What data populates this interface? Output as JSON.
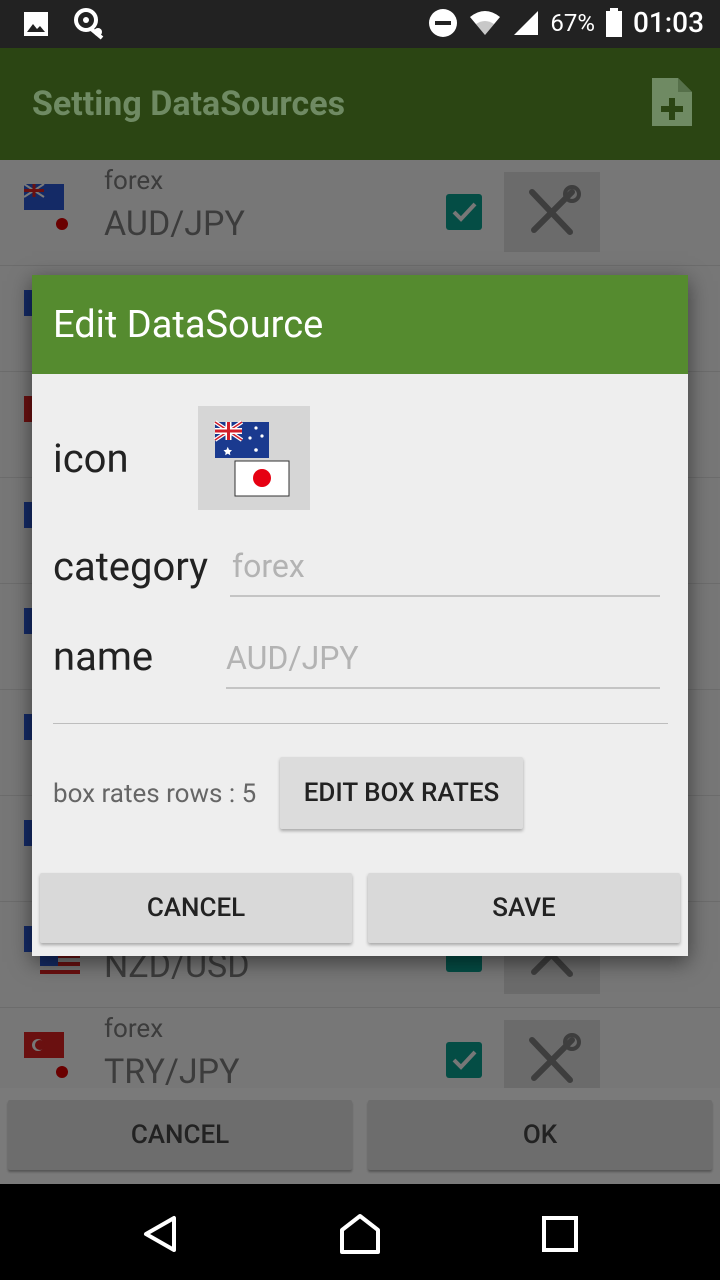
{
  "status_bar": {
    "battery_pct": "67%",
    "time": "01:03",
    "icons": [
      "image-icon",
      "sync-icon",
      "dnd-icon",
      "wifi-icon",
      "signal-icon",
      "battery-icon"
    ]
  },
  "app_bar": {
    "title": "Setting DataSources",
    "add_icon": "add-document-icon"
  },
  "list": {
    "rows": [
      {
        "category": "forex",
        "name": "AUD/JPY",
        "checked": true
      },
      {
        "category": "",
        "name": "",
        "checked": true
      },
      {
        "category": "",
        "name": "",
        "checked": true
      },
      {
        "category": "",
        "name": "",
        "checked": true
      },
      {
        "category": "",
        "name": "",
        "checked": true
      },
      {
        "category": "",
        "name": "",
        "checked": true
      },
      {
        "category": "",
        "name": "",
        "checked": true
      },
      {
        "category": "",
        "name": "NZD/USD",
        "checked": true
      },
      {
        "category": "forex",
        "name": "TRY/JPY",
        "checked": true
      }
    ]
  },
  "bottom_bar": {
    "cancel_label": "CANCEL",
    "ok_label": "OK"
  },
  "dialog": {
    "title": "Edit DataSource",
    "icon_label": "icon",
    "category_label": "category",
    "category_placeholder": "forex",
    "name_label": "name",
    "name_placeholder": "AUD/JPY",
    "box_rates_text": "box rates rows : 5",
    "edit_box_rates_label": "EDIT BOX RATES",
    "cancel_label": "CANCEL",
    "save_label": "SAVE",
    "header_color": "#558b2f"
  },
  "colors": {
    "app_bar": "#2b4513",
    "checkbox": "#00897b"
  }
}
